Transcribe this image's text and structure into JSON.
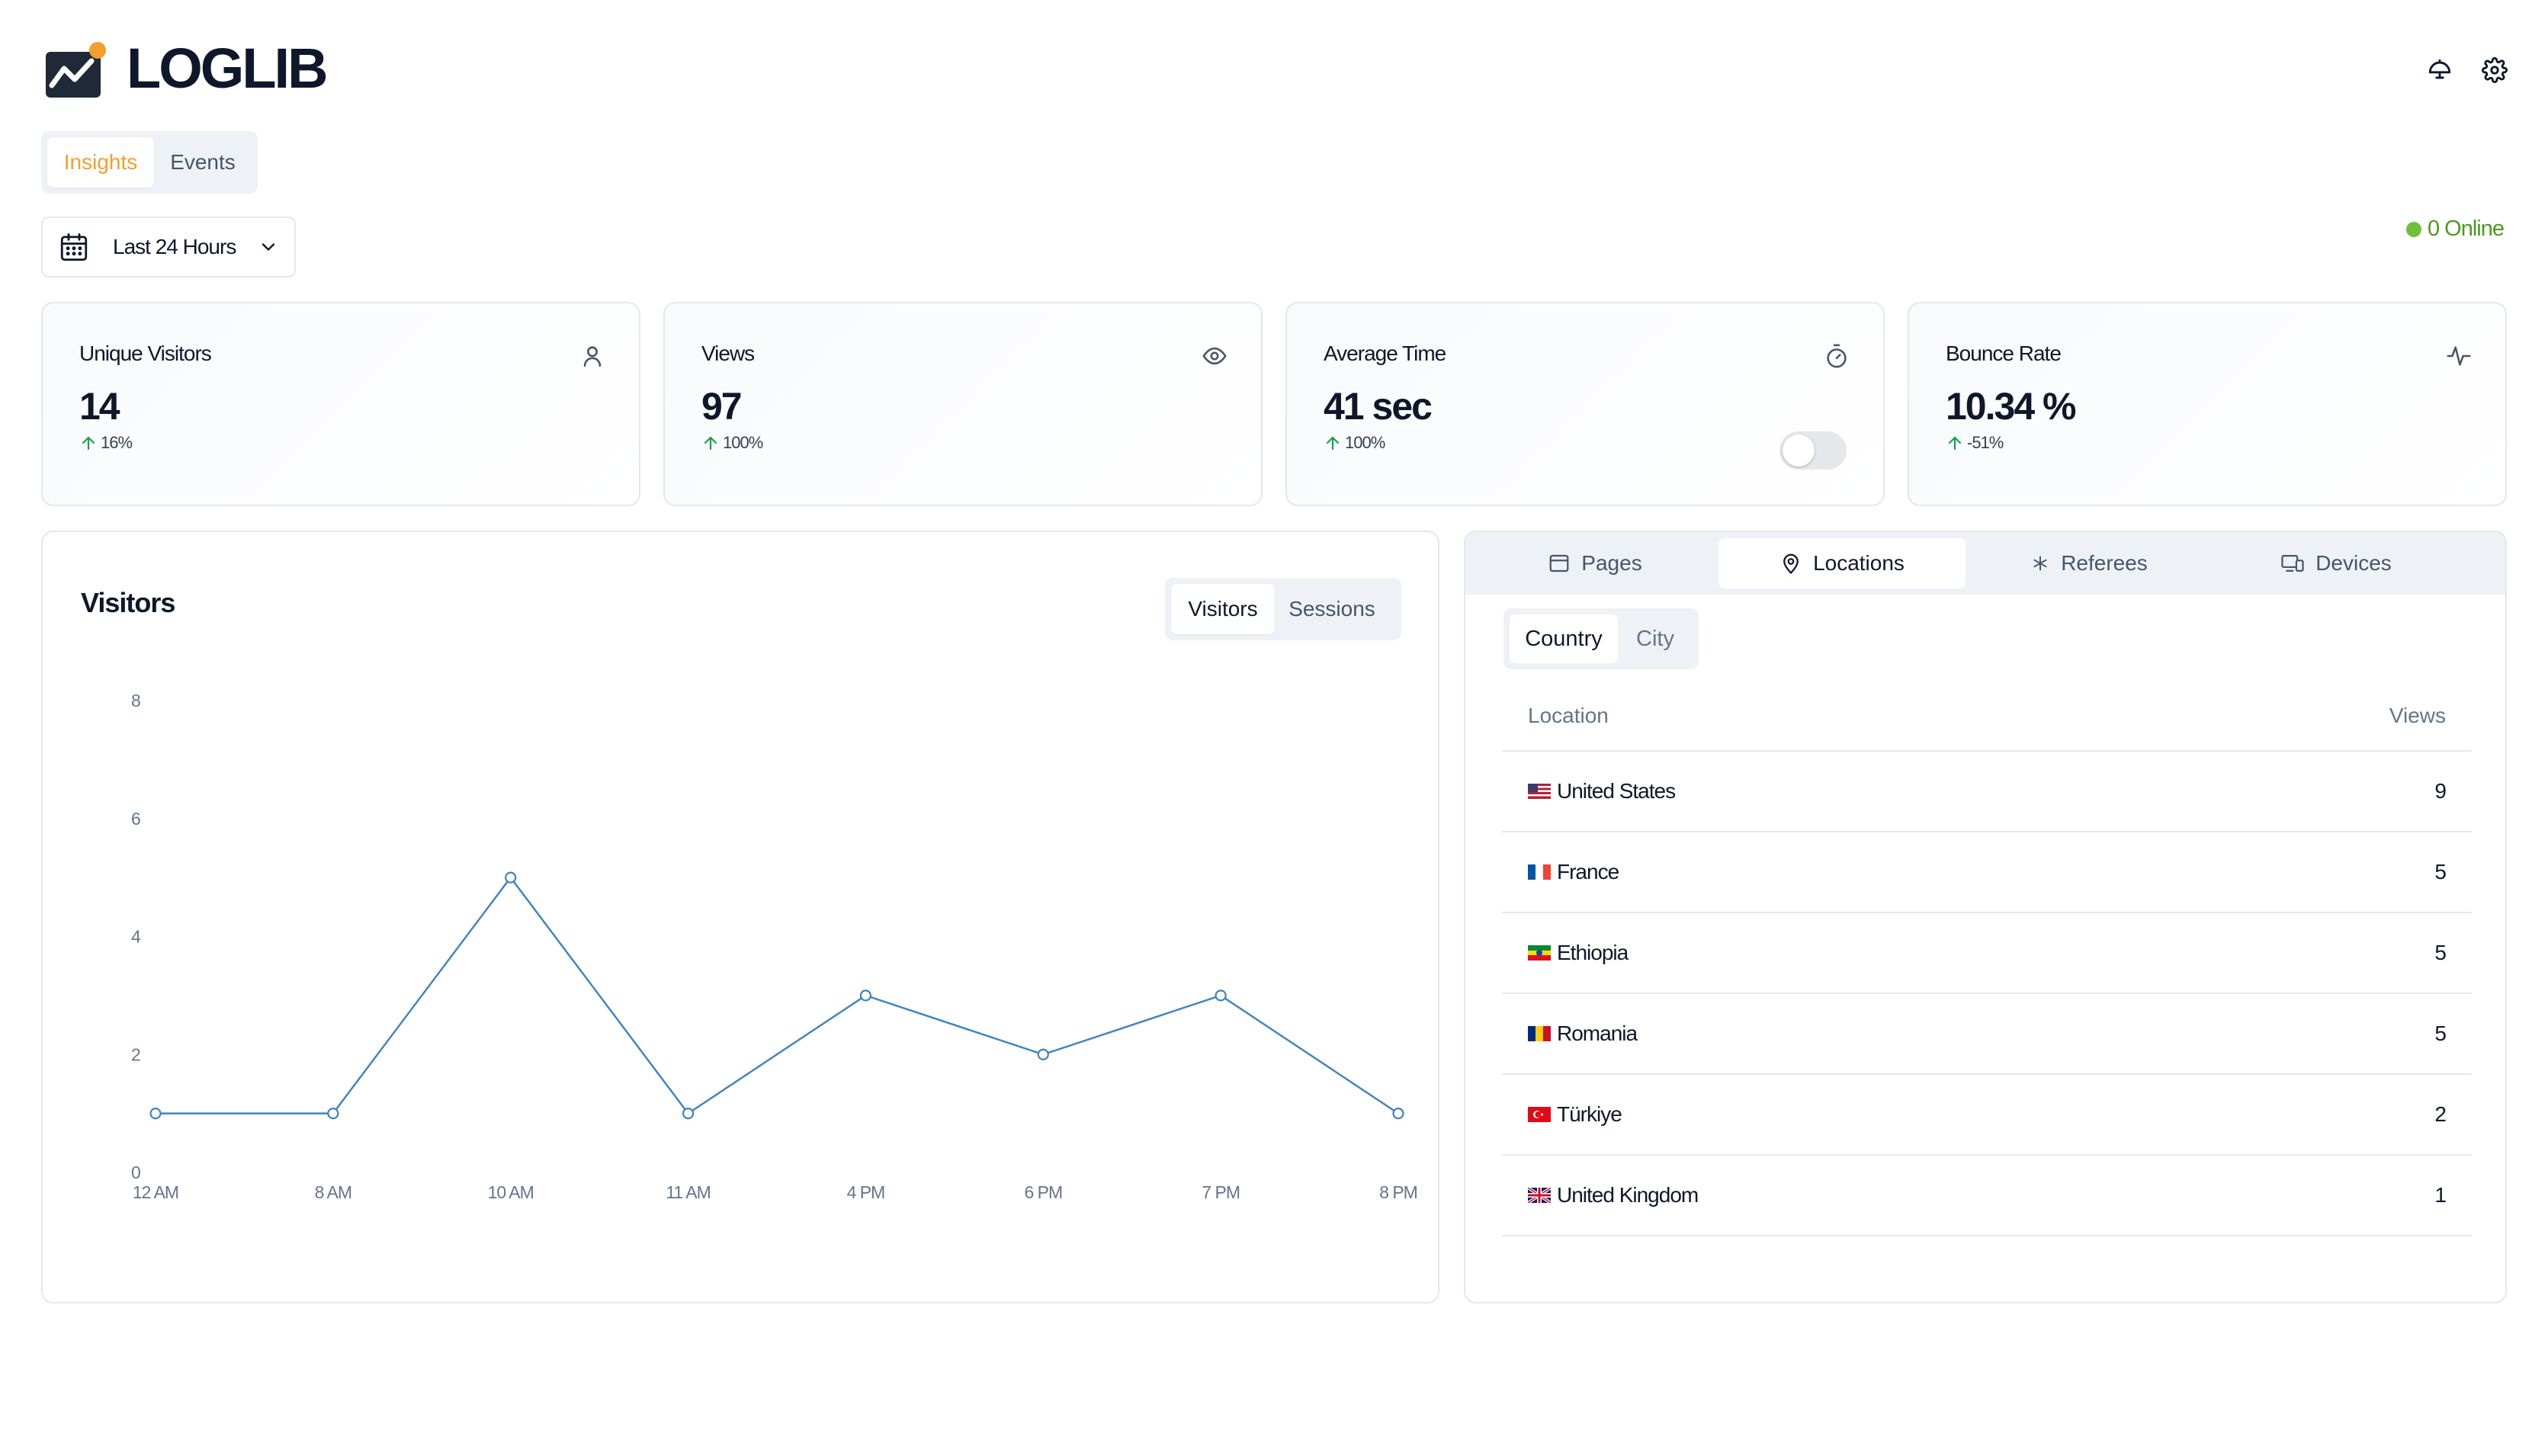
{
  "header": {
    "logo_text": "LOGLIB",
    "icons": [
      "theme-toggle-icon",
      "gear-icon"
    ]
  },
  "nav": {
    "tabs": [
      {
        "label": "Insights",
        "active": true
      },
      {
        "label": "Events",
        "active": false
      }
    ]
  },
  "filters": {
    "date_range": "Last 24 Hours",
    "online_status": "0 Online"
  },
  "stats": [
    {
      "title": "Unique Visitors",
      "value": "14",
      "delta": "16%",
      "icon": "user-icon"
    },
    {
      "title": "Views",
      "value": "97",
      "delta": "100%",
      "icon": "eye-icon"
    },
    {
      "title": "Average Time",
      "value": "41 sec",
      "delta": "100%",
      "icon": "timer-icon"
    },
    {
      "title": "Bounce Rate",
      "value": "10.34 %",
      "delta": "-51%",
      "icon": "activity-icon"
    }
  ],
  "chart_panel": {
    "title": "Visitors",
    "toggle": [
      {
        "label": "Visitors",
        "active": true
      },
      {
        "label": "Sessions",
        "active": false
      }
    ]
  },
  "chart_data": {
    "type": "line",
    "categories": [
      "12 AM",
      "8 AM",
      "10 AM",
      "11 AM",
      "4 PM",
      "6 PM",
      "7 PM",
      "8 PM"
    ],
    "series": [
      {
        "values": [
          1,
          1,
          5,
          1,
          3,
          2,
          3,
          1
        ]
      }
    ],
    "yticks": [
      "0",
      "2",
      "4",
      "6",
      "8"
    ],
    "ylim": [
      0,
      8
    ],
    "xlabel": "",
    "ylabel": "",
    "grid": false,
    "color": "#3b82c4"
  },
  "right_panel": {
    "tabs": [
      {
        "label": "Pages",
        "icon": "browser-window-icon",
        "active": false
      },
      {
        "label": "Locations",
        "icon": "map-pin-icon",
        "active": true
      },
      {
        "label": "Referees",
        "icon": "asterisk-icon",
        "active": false
      },
      {
        "label": "Devices",
        "icon": "devices-icon",
        "active": false
      }
    ],
    "subtabs": [
      {
        "label": "Country",
        "active": true
      },
      {
        "label": "City",
        "active": false
      }
    ],
    "table": {
      "col_location": "Location",
      "col_views": "Views",
      "rows": [
        {
          "country": "United States",
          "views": "9",
          "flag": "us-flag-icon"
        },
        {
          "country": "France",
          "views": "5",
          "flag": "fr-flag-icon"
        },
        {
          "country": "Ethiopia",
          "views": "5",
          "flag": "et-flag-icon"
        },
        {
          "country": "Romania",
          "views": "5",
          "flag": "ro-flag-icon"
        },
        {
          "country": "Türkiye",
          "views": "2",
          "flag": "tr-flag-icon"
        },
        {
          "country": "United Kingdom",
          "views": "1",
          "flag": "gb-flag-icon"
        }
      ]
    }
  },
  "colors": {
    "accent": "#f59e2b",
    "online": "#4d9a1e",
    "delta_up": "#16a34a",
    "chart_line": "#3b82c4"
  }
}
